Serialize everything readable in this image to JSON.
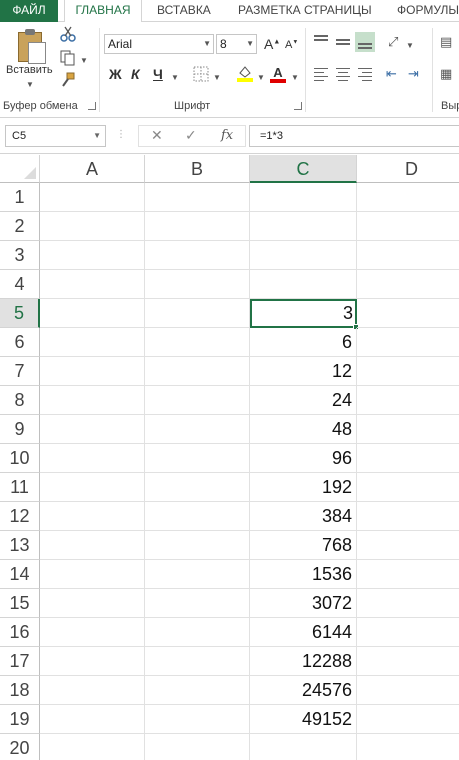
{
  "tabs": {
    "file": "ФАЙЛ",
    "home": "ГЛАВНАЯ",
    "insert": "ВСТАВКА",
    "page_layout": "РАЗМЕТКА СТРАНИЦЫ",
    "formulas": "ФОРМУЛЫ"
  },
  "ribbon": {
    "paste_label": "Вставить",
    "clipboard_group": "Буфер обмена",
    "font_group": "Шрифт",
    "partial_group": "Выр",
    "font_name": "Arial",
    "font_size": "8",
    "bold": "Ж",
    "italic": "К",
    "underline": "Ч",
    "grow_font": "A",
    "shrink_font": "A",
    "font_color_letter": "A",
    "icons": [
      "cut-icon",
      "copy-icon",
      "format-painter-icon",
      "borders-icon",
      "fill-color-icon",
      "font-color-icon",
      "orientation-icon",
      "indent-icon"
    ]
  },
  "formula_bar": {
    "name_box": "C5",
    "fx": "fx",
    "formula": "=1*3"
  },
  "sheet": {
    "columns": [
      "A",
      "B",
      "C",
      "D"
    ],
    "rows": [
      "1",
      "2",
      "3",
      "4",
      "5",
      "6",
      "7",
      "8",
      "9",
      "10",
      "11",
      "12",
      "13",
      "14",
      "15",
      "16",
      "17",
      "18",
      "19",
      "20"
    ],
    "selected_column": "C",
    "selected_row": "5",
    "column_c_values": [
      "",
      "",
      "",
      "",
      "3",
      "6",
      "12",
      "24",
      "48",
      "96",
      "192",
      "384",
      "768",
      "1536",
      "3072",
      "6144",
      "12288",
      "24576",
      "49152",
      ""
    ]
  },
  "colors": {
    "accent": "#217346",
    "header_selected": "#e1e1e1",
    "gridline": "#e1e1e1"
  }
}
